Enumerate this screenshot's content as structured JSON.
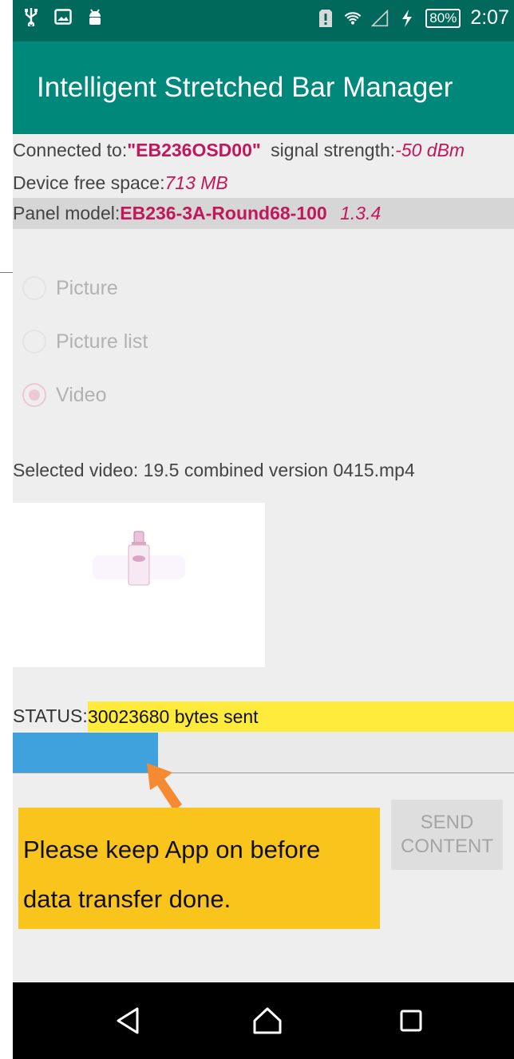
{
  "status_bar": {
    "battery_percent": "80%",
    "time": "2:07",
    "icons": [
      "usb-icon",
      "image-icon",
      "android-icon",
      "sim-alert-icon",
      "wifi-icon",
      "signal-icon",
      "charging-icon",
      "battery-icon"
    ]
  },
  "app_bar": {
    "title": "Intelligent Stretched Bar Manager"
  },
  "connection": {
    "connected_label": "Connected to:",
    "device_name": "\"EB236OSD00\"",
    "signal_label": "signal strength:",
    "signal_value": "-50 dBm",
    "space_label": "Device free space:",
    "space_value": "713 MB",
    "panel_label": "Panel model:",
    "panel_model": "EB236-3A-Round68-100",
    "panel_version": "1.3.4"
  },
  "content_type": {
    "options": [
      {
        "label": "Picture",
        "checked": false
      },
      {
        "label": "Picture list",
        "checked": false
      },
      {
        "label": "Video",
        "checked": true
      }
    ]
  },
  "selected_video": "Selected video: 19.5 combined version 0415.mp4",
  "status": {
    "label": "STATUS:",
    "value": "30023680 bytes sent",
    "progress_fraction": 0.29
  },
  "callout": {
    "line1": "Please keep App on before",
    "line2": "data transfer done."
  },
  "send_button": {
    "line1": "SEND",
    "line2": "CONTENT"
  },
  "colors": {
    "status_bar": "#00695c",
    "app_bar": "#00897b",
    "accent": "#c2185b",
    "status_highlight": "#ffeb3b",
    "progress": "#3fa2dc",
    "callout": "#f9c41b",
    "arrow": "#f58a32"
  },
  "nav_bar": {
    "icons": [
      "back-icon",
      "home-icon",
      "recents-icon"
    ]
  }
}
